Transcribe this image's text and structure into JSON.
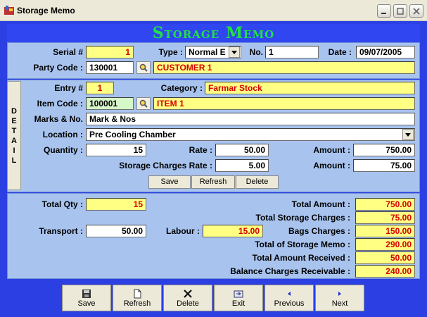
{
  "window": {
    "title": "Storage Memo"
  },
  "header": {
    "title": "Storage Memo"
  },
  "top": {
    "serial_label": "Serial #",
    "serial_value": "1",
    "type_label": "Type :",
    "type_value": "Normal E",
    "no_label": "No.",
    "no_value": "1",
    "date_label": "Date :",
    "date_value": "09/07/2005",
    "party_code_label": "Party Code :",
    "party_code_value": "130001",
    "party_name": "CUSTOMER 1"
  },
  "detail": {
    "tab_letters": [
      "D",
      "E",
      "T",
      "A",
      "I",
      "L"
    ],
    "entry_label": "Entry #",
    "entry_value": "1",
    "category_label": "Category :",
    "category_value": "Farmar Stock",
    "item_code_label": "Item Code :",
    "item_code_value": "100001",
    "item_name": "ITEM 1",
    "marks_label": "Marks & No.",
    "marks_value": "Mark & Nos",
    "location_label": "Location :",
    "location_value": "Pre Cooling Chamber",
    "quantity_label": "Quantity :",
    "quantity_value": "15",
    "rate_label": "Rate :",
    "rate_value": "50.00",
    "amount_label": "Amount :",
    "amount_value": "750.00",
    "storage_rate_label": "Storage Charges Rate :",
    "storage_rate_value": "5.00",
    "amount2_label": "Amount :",
    "amount2_value": "75.00",
    "save_label": "Save",
    "refresh_label": "Refresh",
    "delete_label": "Delete"
  },
  "totals": {
    "total_qty_label": "Total Qty :",
    "total_qty_value": "15",
    "transport_label": "Transport :",
    "transport_value": "50.00",
    "labour_label": "Labour :",
    "labour_value": "15.00",
    "total_amount_label": "Total Amount :",
    "total_amount_value": "750.00",
    "total_storage_label": "Total Storage Charges :",
    "total_storage_value": "75.00",
    "bags_label": "Bags Charges :",
    "bags_value": "150.00",
    "total_memo_label": "Total of Storage Memo :",
    "total_memo_value": "290.00",
    "received_label": "Total Amount Received :",
    "received_value": "50.00",
    "balance_label": "Balance Charges Receivable :",
    "balance_value": "240.00"
  },
  "toolbar": {
    "save": "Save",
    "refresh": "Refresh",
    "delete": "Delete",
    "exit": "Exit",
    "previous": "Previous",
    "next": "Next"
  }
}
